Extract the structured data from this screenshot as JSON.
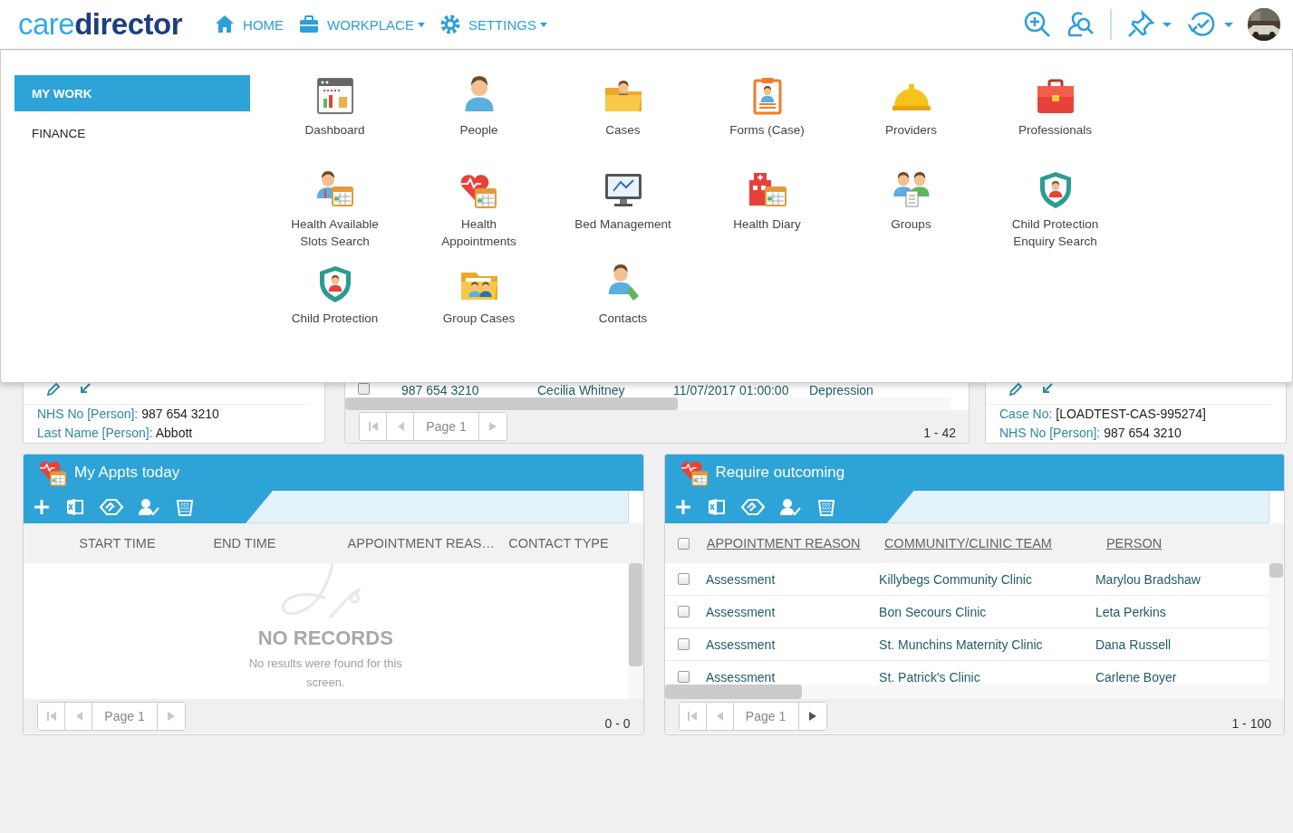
{
  "header": {
    "logo": "care**director**",
    "nav": [
      {
        "label": "HOME",
        "dropdown": false
      },
      {
        "label": "WORKPLACE",
        "dropdown": true
      },
      {
        "label": "SETTINGS",
        "dropdown": true
      }
    ]
  },
  "mega_menu": {
    "categories": [
      {
        "label": "MY WORK",
        "selected": true
      },
      {
        "label": "FINANCE",
        "selected": false
      }
    ],
    "tiles": [
      {
        "label": "Dashboard"
      },
      {
        "label": "People"
      },
      {
        "label": "Cases"
      },
      {
        "label": "Forms (Case)"
      },
      {
        "label": "Providers"
      },
      {
        "label": "Professionals"
      },
      {
        "label": "Health Available Slots Search"
      },
      {
        "label": "Health Appointments"
      },
      {
        "label": "Bed Management"
      },
      {
        "label": "Health Diary"
      },
      {
        "label": "Groups"
      },
      {
        "label": "Child Protection Enquiry Search"
      },
      {
        "label": "Child Protection"
      },
      {
        "label": "Group Cases"
      },
      {
        "label": "Contacts"
      }
    ]
  },
  "background_cards": {
    "person_card": {
      "fields": [
        {
          "label": "NHS No [Person]:",
          "value": "987 654 3210"
        },
        {
          "label": "Last Name [Person]:",
          "value": "Abbott"
        }
      ]
    },
    "list_card": {
      "row": {
        "checked": false,
        "cells": [
          "987 654 3210",
          "Cecilia Whitney",
          "11/07/2017 01:00:00",
          "Depression"
        ]
      },
      "pager": {
        "page": "Page 1",
        "range": "1 - 42",
        "next_disabled": true
      }
    },
    "case_card": {
      "fields": [
        {
          "label": "Case No:",
          "value": "[LOADTEST-CAS-995274]"
        },
        {
          "label": "NHS No [Person]:",
          "value": "987 654 3210"
        }
      ]
    }
  },
  "widgets": [
    {
      "title": "My Appts today",
      "columns": [
        {
          "label": "START TIME",
          "sortable": false
        },
        {
          "label": "END TIME",
          "sortable": false
        },
        {
          "label": "APPOINTMENT REAS…",
          "sortable": false
        },
        {
          "label": "CONTACT TYPE",
          "sortable": false
        }
      ],
      "empty": {
        "title": "NO RECORDS",
        "message": "No results were found for this screen."
      },
      "pager": {
        "page": "Page 1",
        "range": "0 - 0",
        "next_disabled": true
      }
    },
    {
      "title": "Require outcoming",
      "select_all": {
        "checked": false
      },
      "columns": [
        {
          "label": "APPOINTMENT REASON",
          "sortable": true
        },
        {
          "label": "COMMUNITY/CLINIC TEAM",
          "sortable": true
        },
        {
          "label": "PERSON",
          "sortable": true
        }
      ],
      "rows": [
        {
          "checked": false,
          "cells": [
            "Assessment",
            "Killybegs Community Clinic",
            "Marylou Bradshaw"
          ]
        },
        {
          "checked": false,
          "cells": [
            "Assessment",
            "Bon Secours Clinic",
            "Leta Perkins"
          ]
        },
        {
          "checked": false,
          "cells": [
            "Assessment",
            "St. Munchins Maternity Clinic",
            "Dana Russell"
          ]
        },
        {
          "checked": false,
          "cells": [
            "Assessment",
            "St. Patrick's Clinic",
            "Carlene Boyer"
          ]
        }
      ],
      "pager": {
        "page": "Page 1",
        "range": "1 - 100",
        "next_disabled": false
      }
    }
  ]
}
